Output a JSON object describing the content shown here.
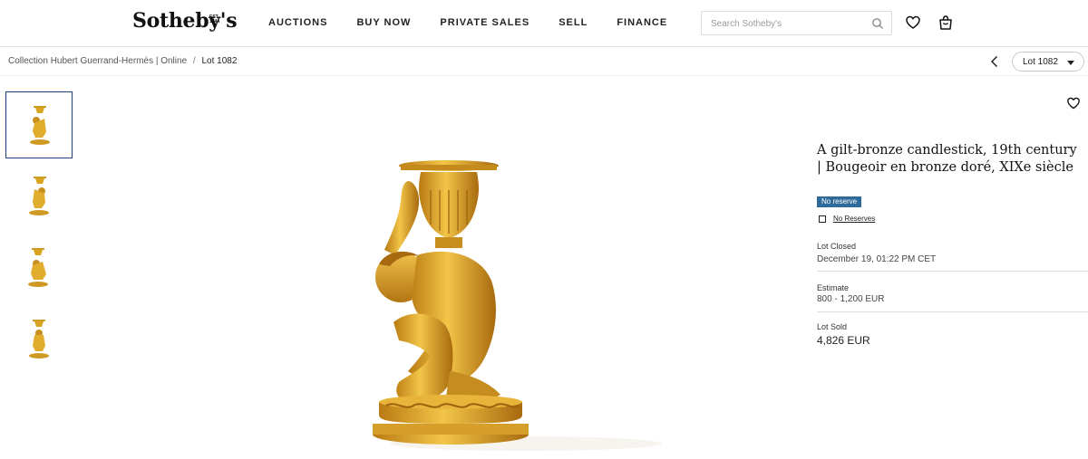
{
  "header": {
    "logo": "Sotheby's",
    "logo_est": "EST. 1744",
    "nav": [
      "AUCTIONS",
      "BUY NOW",
      "PRIVATE SALES",
      "SELL",
      "FINANCE"
    ],
    "search_placeholder": "Search Sotheby's"
  },
  "breadcrumb": {
    "collection": "Collection Hubert Guerrand-Hermès | Online",
    "separator": "/",
    "current": "Lot 1082"
  },
  "lot_selector": {
    "label": "Lot 1082"
  },
  "lot": {
    "title": "A gilt-bronze candlestick, 19th century | Bougeoir en bronze doré, XIXe siècle",
    "badge": "No reserve",
    "checkbox_label": "No Reserves",
    "closed_label": "Lot Closed",
    "closed_value": "December 19, 01:22 PM CET",
    "estimate_label": "Estimate",
    "estimate_value": "800 - 1,200 EUR",
    "sold_label": "Lot Sold",
    "sold_value": "4,826 EUR"
  },
  "icons": {
    "search": "search-icon",
    "favorites": "heart-icon",
    "bag": "shopping-bag-icon",
    "prev": "chevron-left-icon",
    "caret": "caret-down-icon"
  },
  "colors": {
    "badge": "#2f6b9a",
    "active_thumb": "#1f3f78",
    "gold": "#d9a520"
  }
}
